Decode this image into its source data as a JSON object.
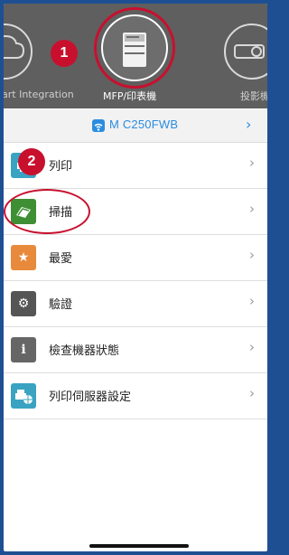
{
  "carousel": {
    "left_label": "art Integration",
    "center_label": "MFP/印表機",
    "right_label": "投影機"
  },
  "annotations": {
    "step1": "1",
    "step2": "2"
  },
  "device": {
    "name": "M C250FWB",
    "chevron": "›"
  },
  "menu": {
    "items": [
      {
        "label": "列印",
        "icon": "print-icon",
        "color": "#3aa3c2"
      },
      {
        "label": "掃描",
        "icon": "scan-icon",
        "color": "#3e8f34"
      },
      {
        "label": "最愛",
        "icon": "star-icon",
        "color": "#e88a3b"
      },
      {
        "label": "驗證",
        "icon": "gear-icon",
        "color": "#555555"
      },
      {
        "label": "檢查機器狀態",
        "icon": "info-icon",
        "color": "#666666"
      },
      {
        "label": "列印伺服器設定",
        "icon": "print-server-icon",
        "color": "#3aa3c2"
      }
    ]
  },
  "colors": {
    "accent": "#2a8de0",
    "annotation_red": "#c8102e",
    "header_bg": "#5f5f5f",
    "outer_bg": "#1f4f93"
  }
}
